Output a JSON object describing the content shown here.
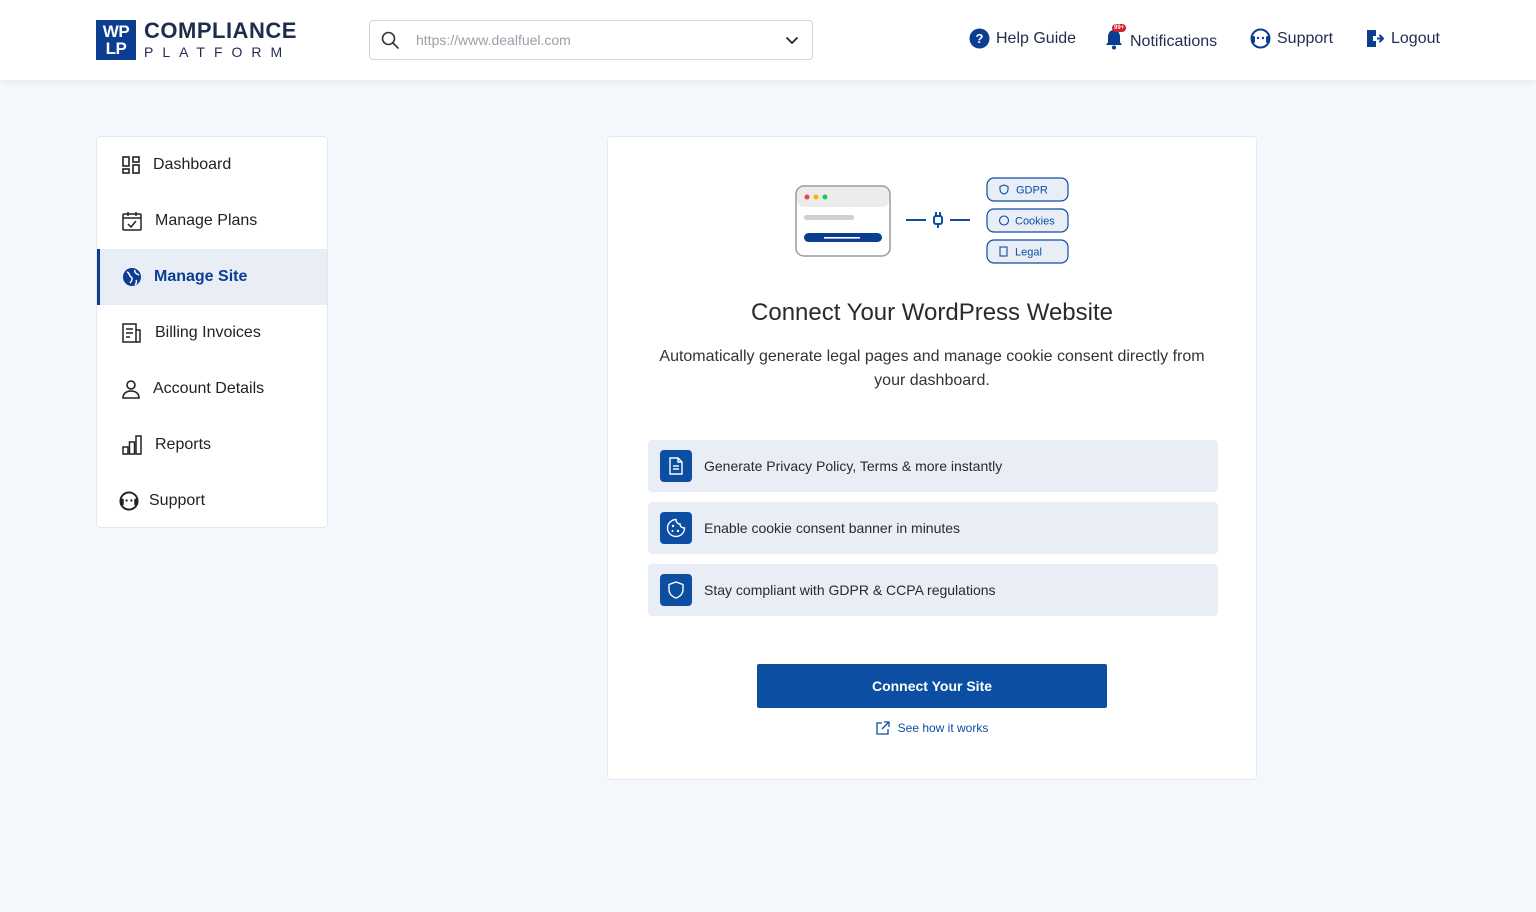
{
  "brand": {
    "mark_line1": "WP",
    "mark_line2": "LP",
    "name": "COMPLIANCE",
    "tagline": "PLATFORM"
  },
  "header": {
    "url_placeholder": "https://www.dealfuel.com",
    "nav": {
      "help": "Help Guide",
      "notifications": "Notifications",
      "notifications_badge": "99+",
      "support": "Support",
      "logout": "Logout"
    }
  },
  "sidebar": {
    "items": [
      {
        "label": "Dashboard",
        "icon": "dashboard-icon"
      },
      {
        "label": "Manage Plans",
        "icon": "calendar-check-icon"
      },
      {
        "label": "Manage Site",
        "icon": "globe-icon",
        "active": true
      },
      {
        "label": "Billing Invoices",
        "icon": "invoice-icon"
      },
      {
        "label": "Account Details",
        "icon": "user-icon"
      },
      {
        "label": "Reports",
        "icon": "bar-chart-icon"
      },
      {
        "label": "Support",
        "icon": "support-icon"
      }
    ]
  },
  "card": {
    "illustration": {
      "tags": [
        "GDPR",
        "Cookies",
        "Legal"
      ]
    },
    "title": "Connect Your WordPress Website",
    "subtitle": "Automatically generate legal pages and manage cookie consent directly from your dashboard.",
    "features": [
      {
        "text": "Generate Privacy Policy, Terms & more instantly",
        "icon": "document-icon"
      },
      {
        "text": "Enable cookie consent banner in minutes",
        "icon": "cookie-icon"
      },
      {
        "text": "Stay compliant with GDPR & CCPA regulations",
        "icon": "shield-icon"
      }
    ],
    "cta_label": "Connect Your Site",
    "how_label": "See how it works"
  },
  "colors": {
    "primary": "#0b4ea2",
    "brand_dark": "#0b3d91",
    "background": "#f4f7fc",
    "feature_bg": "#e8edf6"
  }
}
